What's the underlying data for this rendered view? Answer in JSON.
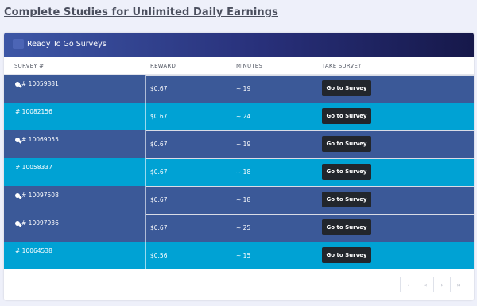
{
  "page_title": "Complete Studies for Unlimited Daily Earnings",
  "panel_title": "Ready To Go Surveys",
  "columns": {
    "survey": "SURVEY #",
    "reward": "REWARD",
    "minutes": "MINUTES",
    "take": "TAKE SURVEY"
  },
  "rows": [
    {
      "id": "# 10059881",
      "reward": "$0.67",
      "minutes": "~ 19",
      "button": "Go to Survey",
      "tagged": true,
      "style": "dark"
    },
    {
      "id": "# 10082156",
      "reward": "$0.67",
      "minutes": "~ 24",
      "button": "Go to Survey",
      "tagged": false,
      "style": "light"
    },
    {
      "id": "# 10069055",
      "reward": "$0.67",
      "minutes": "~ 19",
      "button": "Go to Survey",
      "tagged": true,
      "style": "dark"
    },
    {
      "id": "# 10058337",
      "reward": "$0.67",
      "minutes": "~ 18",
      "button": "Go to Survey",
      "tagged": false,
      "style": "light"
    },
    {
      "id": "# 10097508",
      "reward": "$0.67",
      "minutes": "~ 18",
      "button": "Go to Survey",
      "tagged": true,
      "style": "dark"
    },
    {
      "id": "# 10097936",
      "reward": "$0.67",
      "minutes": "~ 25",
      "button": "Go to Survey",
      "tagged": true,
      "style": "dark"
    },
    {
      "id": "# 10064538",
      "reward": "$0.56",
      "minutes": "~ 15",
      "button": "Go to Survey",
      "tagged": false,
      "style": "light"
    }
  ],
  "pagination": {
    "first": "‹",
    "prev": "«",
    "next": "›",
    "last": "»"
  },
  "colors": {
    "dark_row": "#3b5998",
    "light_row": "#00a2d4",
    "button": "#22262c"
  }
}
